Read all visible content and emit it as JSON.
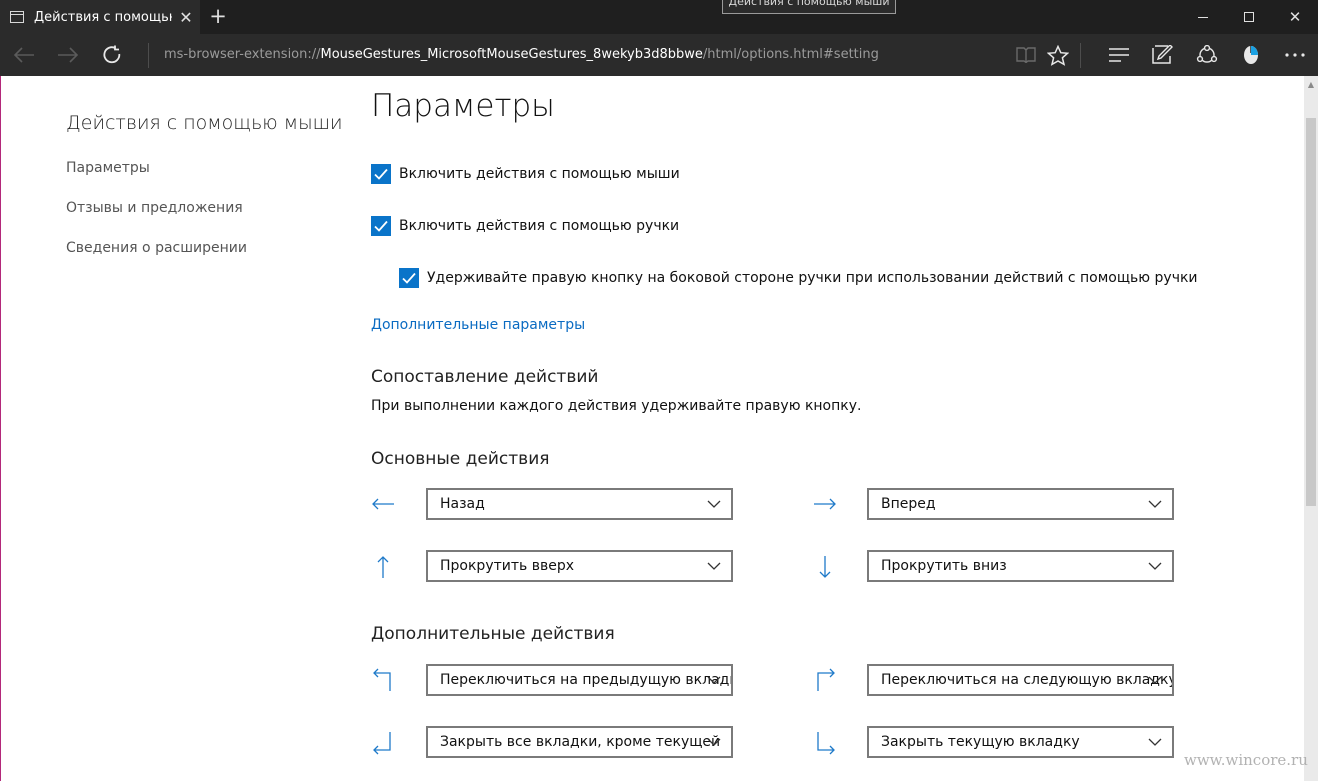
{
  "browser": {
    "tab_title": "Действия с помощью мыши",
    "tab_close_label": "✕",
    "new_tab_label": "+",
    "tooltip": "Действия с помощью мыши",
    "url_scheme": "ms-browser-extension://",
    "url_host": "MouseGestures_MicrosoftMouseGestures_8wekyb3d8bbwe",
    "url_path": "/html/options.html#setting",
    "window_close_label": "✕"
  },
  "sidebar": {
    "title": "Действия с помощью мыши",
    "links": [
      {
        "label": "Параметры"
      },
      {
        "label": "Отзывы и предложения"
      },
      {
        "label": "Сведения о расширении"
      }
    ]
  },
  "main": {
    "title": "Параметры",
    "options": [
      {
        "label": "Включить действия с помощью мыши",
        "checked": true
      },
      {
        "label": "Включить действия с помощью ручки",
        "checked": true
      },
      {
        "label": "Удерживайте правую кнопку на боковой стороне ручки при использовании действий с помощью ручки",
        "checked": true
      }
    ],
    "advanced_link": "Дополнительные параметры",
    "mapping_title": "Сопоставление действий",
    "mapping_desc": "При выполнении каждого действия удерживайте правую кнопку.",
    "basic_title": "Основные действия",
    "basic_gestures": [
      {
        "gesture": "left-arrow-icon",
        "value": "Назад"
      },
      {
        "gesture": "right-arrow-icon",
        "value": "Вперед"
      },
      {
        "gesture": "up-arrow-icon",
        "value": "Прокрутить вверх"
      },
      {
        "gesture": "down-arrow-icon",
        "value": "Прокрутить вниз"
      }
    ],
    "extra_title": "Дополнительные действия",
    "extra_gestures": [
      {
        "gesture": "up-left-arrow-icon",
        "value": "Переключиться на предыдущую вкладку"
      },
      {
        "gesture": "up-right-arrow-icon",
        "value": "Переключиться на следующую вкладку"
      },
      {
        "gesture": "down-left-arrow-icon",
        "value": "Закрыть все вкладки, кроме текущей"
      },
      {
        "gesture": "down-right-arrow-icon",
        "value": "Закрыть текущую вкладку"
      }
    ]
  },
  "watermark": "www.wincore.ru",
  "colors": {
    "accent": "#0a74c9",
    "link": "#0a6bc2",
    "chrome_dark": "#2b2b2b"
  }
}
